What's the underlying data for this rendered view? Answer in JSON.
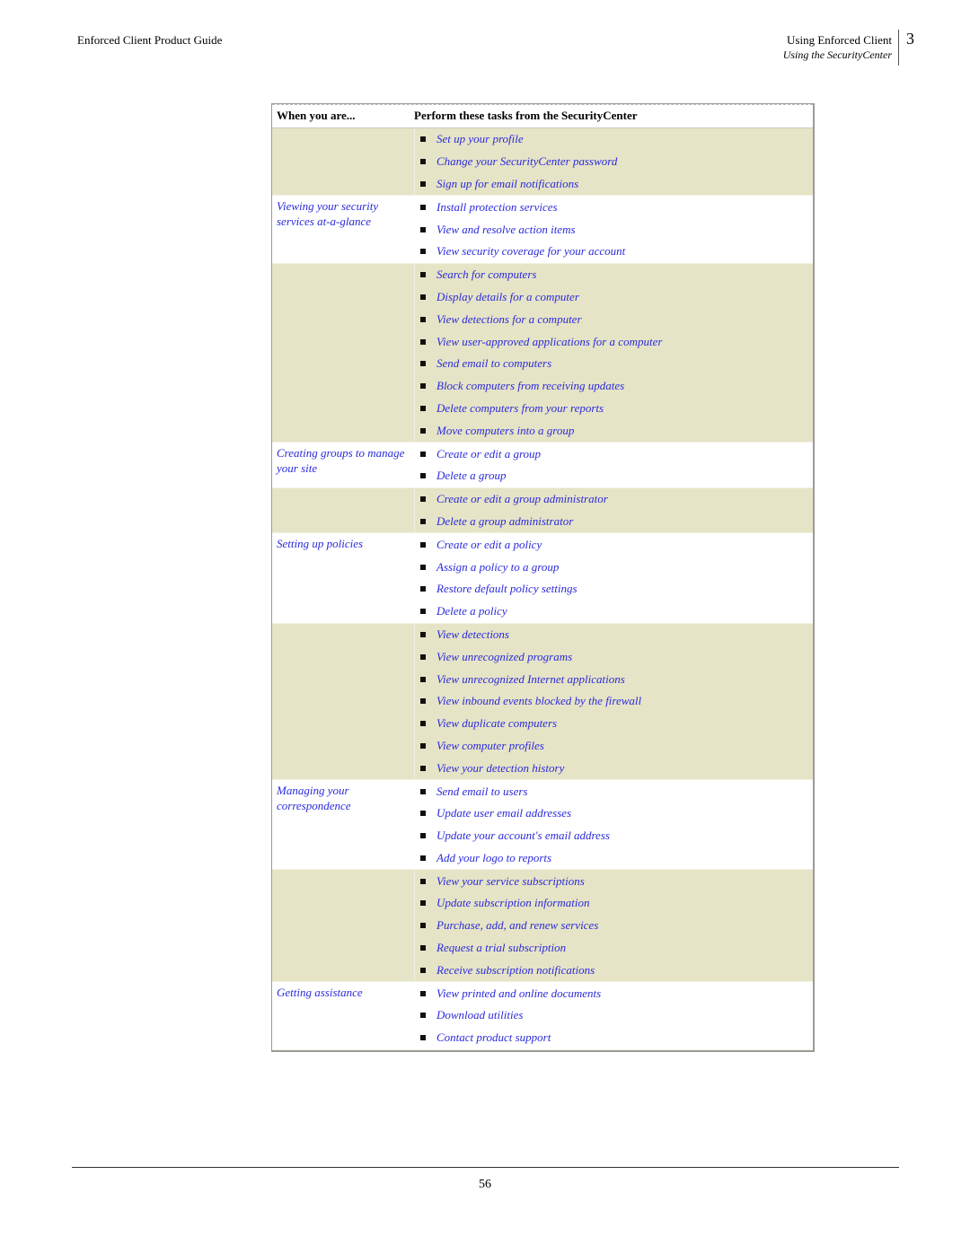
{
  "header": {
    "left_title": "Enforced Client Product Guide",
    "right_title": "Using Enforced Client",
    "right_subtitle": "Using the SecurityCenter",
    "chapter_number": "3"
  },
  "table": {
    "columns": [
      "When you are...",
      "Perform these tasks from the SecurityCenter"
    ],
    "groups": [
      {
        "context": "",
        "shaded": true,
        "tasks": [
          "Set up your profile",
          "Change your SecurityCenter password",
          "Sign up for email notifications"
        ]
      },
      {
        "context": "Viewing your security services at-a-glance",
        "shaded": false,
        "tasks": [
          "Install protection services",
          "View and resolve action items",
          "View security coverage for your account"
        ]
      },
      {
        "context": "",
        "shaded": true,
        "tasks": [
          "Search for computers",
          "Display details for a computer",
          "View detections for a computer",
          "View user-approved applications for a computer",
          "Send email to computers",
          "Block computers from receiving updates",
          "Delete computers from your reports",
          "Move computers into a group"
        ]
      },
      {
        "context": "Creating groups to manage your site",
        "shaded": false,
        "tasks": [
          "Create or edit a group",
          "Delete a group"
        ]
      },
      {
        "context": "",
        "shaded": true,
        "tasks": [
          "Create or edit a group administrator",
          "Delete a group administrator"
        ]
      },
      {
        "context": "Setting up policies",
        "shaded": false,
        "tasks": [
          "Create or edit a policy",
          "Assign a policy to a group",
          "Restore default policy settings",
          "Delete a policy"
        ]
      },
      {
        "context": "",
        "shaded": true,
        "tasks": [
          "View detections",
          "View unrecognized programs",
          "View unrecognized Internet applications",
          "View inbound events blocked by the firewall",
          "View duplicate computers",
          "View computer profiles",
          "View your detection history"
        ]
      },
      {
        "context": "Managing your correspondence",
        "shaded": false,
        "tasks": [
          "Send email to users",
          "Update user email addresses",
          "Update your account's email address",
          "Add your logo to reports"
        ]
      },
      {
        "context": "",
        "shaded": true,
        "tasks": [
          "View your service subscriptions",
          "Update subscription information",
          "Purchase, add, and renew services",
          "Request a trial subscription",
          "Receive subscription notifications"
        ]
      },
      {
        "context": "Getting assistance",
        "shaded": false,
        "tasks": [
          "View printed and online documents",
          "Download utilities",
          "Contact product support"
        ]
      }
    ]
  },
  "footer": {
    "page_number": "56"
  },
  "colors": {
    "link": "#2a2adc",
    "shaded_row": "#e6e4c6"
  }
}
